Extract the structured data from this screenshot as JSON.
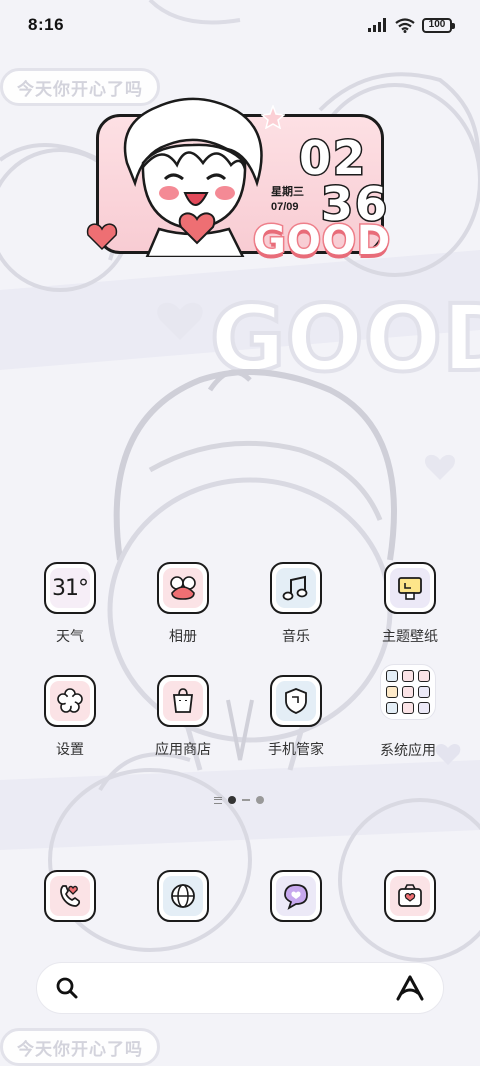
{
  "status_bar": {
    "time": "8:16",
    "battery": "100",
    "icons": [
      "signal-icon",
      "wifi-icon",
      "battery-icon"
    ]
  },
  "wallpaper": {
    "tag_text": "今天你开心了吗",
    "bg_word": "GOOD"
  },
  "clock_widget": {
    "hour": "02",
    "minute": "36",
    "weekday": "星期三",
    "date": "07/09",
    "banner": "GOOD"
  },
  "apps_row1": [
    {
      "label": "天气",
      "icon": "weather-icon",
      "value": "31°"
    },
    {
      "label": "相册",
      "icon": "gallery-icon"
    },
    {
      "label": "音乐",
      "icon": "music-icon"
    },
    {
      "label": "主题壁纸",
      "icon": "theme-icon"
    }
  ],
  "apps_row2": [
    {
      "label": "设置",
      "icon": "settings-icon"
    },
    {
      "label": "应用商店",
      "icon": "app-store-icon"
    },
    {
      "label": "手机管家",
      "icon": "phone-manager-icon"
    },
    {
      "label": "系统应用",
      "icon": "folder-icon"
    }
  ],
  "dock": [
    {
      "icon": "phone-icon"
    },
    {
      "icon": "browser-icon"
    },
    {
      "icon": "messages-icon"
    },
    {
      "icon": "camera-icon"
    }
  ],
  "colors": {
    "accent_pink": "#f8ccd3",
    "heart_red": "#ee6f73",
    "outline": "#1b1b1b",
    "bg": "#f3f3f8"
  }
}
